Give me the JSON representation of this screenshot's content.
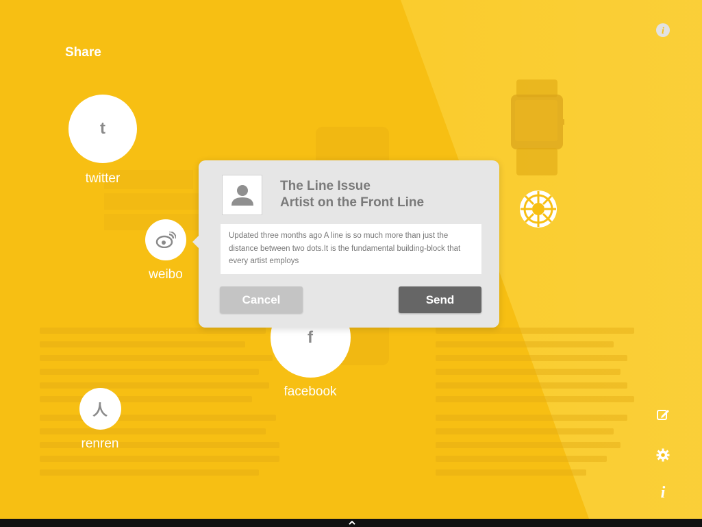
{
  "share": {
    "title": "Share"
  },
  "networks": [
    {
      "label": "twitter",
      "glyph": "t"
    },
    {
      "label": "weibo",
      "glyph": "weibo"
    },
    {
      "label": "facebook",
      "glyph": "f"
    },
    {
      "label": "renren",
      "glyph": "人"
    }
  ],
  "dialog": {
    "title_line1": "The Line Issue",
    "title_line2": "Artist on the Front Line",
    "body": "Updated three months ago A line is so much more than just the distance between two dots.It is the fundamental building-block that every artist employs",
    "cancel_label": "Cancel",
    "send_label": "Send"
  },
  "icons": {
    "info_top": "info-icon",
    "edit": "edit-icon",
    "settings": "gear-icon",
    "info_bottom": "info-icon"
  },
  "colors": {
    "background": "#f7bf13",
    "dialog": "#e6e6e6",
    "send": "#666666",
    "cancel": "#c4c4c4"
  }
}
